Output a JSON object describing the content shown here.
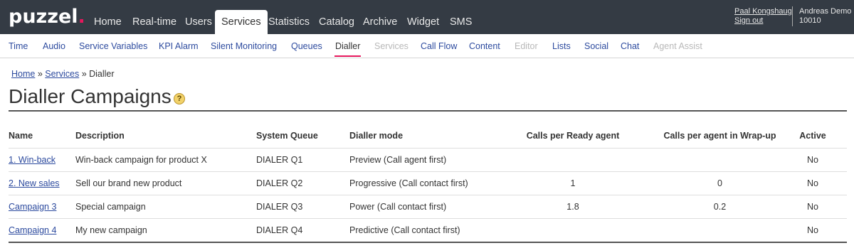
{
  "logo": {
    "text": "puzzel",
    "dot": "."
  },
  "main_nav": [
    "Home",
    "Real-time",
    "Users",
    "Services",
    "Statistics",
    "Catalog",
    "Archive",
    "Widget",
    "SMS"
  ],
  "main_nav_active": "Services",
  "user": {
    "name": "Paal Kongshaug",
    "sign_out": "Sign out"
  },
  "company": {
    "name": "Andreas Demo",
    "id": "10010"
  },
  "sub_nav": [
    {
      "label": "Time",
      "state": "link"
    },
    {
      "label": "Audio",
      "state": "link"
    },
    {
      "label": "Service Variables",
      "state": "link"
    },
    {
      "label": "KPI Alarm",
      "state": "link"
    },
    {
      "label": "Silent Monitoring",
      "state": "link"
    },
    {
      "label": "Queues",
      "state": "link"
    },
    {
      "label": "Dialler",
      "state": "active"
    },
    {
      "label": "Services",
      "state": "disabled"
    },
    {
      "label": "Call Flow",
      "state": "link"
    },
    {
      "label": "Content",
      "state": "link"
    },
    {
      "label": "Editor",
      "state": "disabled"
    },
    {
      "label": "Lists",
      "state": "link"
    },
    {
      "label": "Social",
      "state": "link"
    },
    {
      "label": "Chat",
      "state": "link"
    },
    {
      "label": "Agent Assist",
      "state": "disabled"
    }
  ],
  "breadcrumb": {
    "home": "Home",
    "services": "Services",
    "current": "Dialler",
    "separator": "»"
  },
  "page_title": "Dialler Campaigns",
  "help_icon": "?",
  "table": {
    "headers": [
      "Name",
      "Description",
      "System Queue",
      "Dialler mode",
      "Calls per Ready agent",
      "Calls per agent in Wrap-up",
      "Active"
    ],
    "rows": [
      [
        "1. Win-back",
        "Win-back campaign for product X",
        "DIALER Q1",
        "Preview (Call agent first)",
        "",
        "",
        "No"
      ],
      [
        "2. New sales",
        "Sell our brand new product",
        "DIALER Q2",
        "Progressive (Call contact first)",
        "1",
        "0",
        "No"
      ],
      [
        "Campaign 3",
        "Special campaign",
        "DIALER Q3",
        "Power (Call contact first)",
        "1.8",
        "0.2",
        "No"
      ],
      [
        "Campaign 4",
        "My new campaign",
        "DIALER Q4",
        "Predictive (Call contact first)",
        "",
        "",
        "No"
      ]
    ]
  },
  "colors": {
    "topbar": "#343b44",
    "accent": "#e6175c",
    "link": "#2c4a9e"
  }
}
